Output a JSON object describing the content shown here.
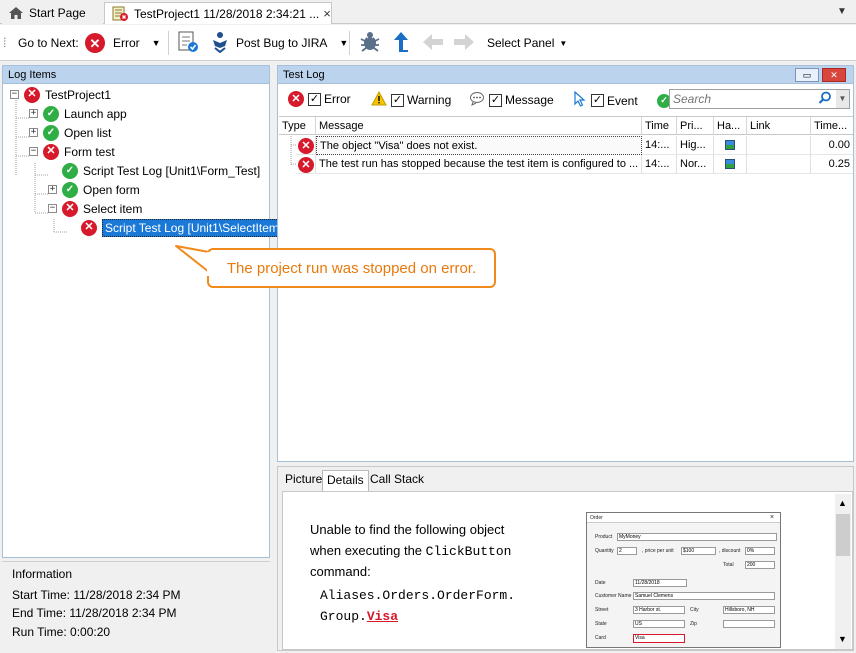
{
  "tabs": [
    {
      "label": "Start Page",
      "icon": "home-icon"
    },
    {
      "label": "TestProject1 11/28/2018 2:34:21 ...",
      "icon": "log-icon",
      "close": "×"
    }
  ],
  "tabbar": {
    "dropdown": "▼"
  },
  "toolbar": {
    "go_to_next": "Go to Next:",
    "error_filter": "Error",
    "post_bug": "Post Bug to JIRA",
    "select_panel": "Select Panel"
  },
  "log_items": {
    "title": "Log Items",
    "nodes": [
      {
        "label": "TestProject1",
        "status": "error",
        "expander": "−"
      },
      {
        "label": "Launch app",
        "status": "ok",
        "expander": "+"
      },
      {
        "label": "Open list",
        "status": "ok",
        "expander": "+"
      },
      {
        "label": "Form test",
        "status": "error",
        "expander": "−"
      },
      {
        "label": "Script Test Log [Unit1\\Form_Test]",
        "status": "ok",
        "expander": ""
      },
      {
        "label": "Open form",
        "status": "ok",
        "expander": "+"
      },
      {
        "label": "Select item",
        "status": "error",
        "expander": "−"
      },
      {
        "label": "Script Test Log [Unit1\\SelectItem]",
        "status": "error",
        "expander": "",
        "selected": true
      }
    ]
  },
  "information": {
    "title": "Information",
    "start": "Start Time: 11/28/2018 2:34 PM",
    "end": "End Time: 11/28/2018 2:34 PM",
    "run": "Run Time: 0:00:20"
  },
  "test_log": {
    "title": "Test Log",
    "filters": [
      "Error",
      "Warning",
      "Message",
      "Event"
    ],
    "search_placeholder": "Search",
    "columns": [
      "Type",
      "Message",
      "Time",
      "Pri...",
      "Ha...",
      "Link",
      "Time..."
    ],
    "rows": [
      {
        "message": "The object \"Visa\" does not exist.",
        "time": "14:...",
        "priority": "Hig...",
        "link": "",
        "time_diff": "0.00"
      },
      {
        "message": "The test run has stopped because the test item is configured to ...",
        "time": "14:...",
        "priority": "Nor...",
        "link": "",
        "time_diff": "0.25"
      }
    ]
  },
  "bottom_tabs": [
    "Picture",
    "Details",
    "Call Stack"
  ],
  "details": {
    "line1": "Unable to find the following object",
    "line2a": "when executing the ",
    "line2b": "ClickButton",
    "line3": "command:",
    "code1": "Aliases.Orders.OrderForm.",
    "code2a": "Group.",
    "code2b": "Visa"
  },
  "thumbnail": {
    "title": "Order",
    "product_label": "Product",
    "product_value": "MyMoney",
    "quantity_label": "Quantity",
    "quantity_value": "2",
    "price_label": ", price per unit",
    "price_value": "$100",
    "discount_label": ", discount",
    "discount_value": "0%",
    "total_label": "Total",
    "total_value": "200",
    "date_label": "Date",
    "date_value": "11/28/2018",
    "customer_label": "Customer Name",
    "customer_value": "Samuel Clemens",
    "street_label": "Street",
    "street_value": "3 Harbor st.",
    "city_label": "City",
    "city_value": "Hillsboro, NH",
    "state_label": "State",
    "state_value": "US",
    "zip_label": "Zip",
    "card_label": "Card",
    "card_value": "Visa"
  },
  "callout": "The project run was stopped on error.",
  "colors": {
    "error": "#d6192b",
    "ok": "#2fae45",
    "selection": "#1a78d6",
    "callout": "#f08a1c"
  }
}
